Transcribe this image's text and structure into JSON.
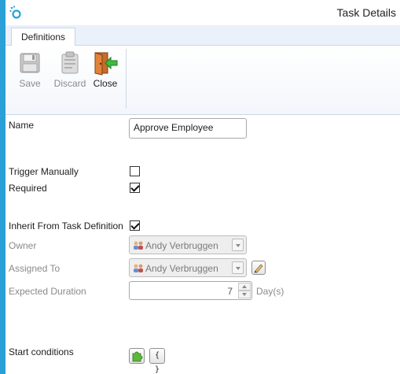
{
  "window": {
    "title": "Task Details"
  },
  "ribbon": {
    "tab": "Definitions",
    "save_label": "Save",
    "discard_label": "Discard",
    "close_label": "Close"
  },
  "form": {
    "name_label": "Name",
    "name_value": "Approve Employee",
    "trigger_manually_label": "Trigger Manually",
    "trigger_manually_checked": false,
    "required_label": "Required",
    "required_checked": true,
    "inherit_label": "Inherit From Task Definition",
    "inherit_checked": true,
    "owner_label": "Owner",
    "owner_value": "Andy Verbruggen",
    "assigned_label": "Assigned To",
    "assigned_value": "Andy Verbruggen",
    "duration_label": "Expected Duration",
    "duration_value": "7",
    "duration_unit": "Day(s)",
    "start_conditions_label": "Start conditions",
    "braces_label": "{ }"
  },
  "icons": {
    "app": "app-logo-icon",
    "save": "floppy-disk-icon",
    "discard": "clipboard-icon",
    "close": "door-exit-icon",
    "person": "person-icon",
    "edit": "pencil-icon",
    "puzzle": "puzzle-icon"
  },
  "colors": {
    "accent": "#2aa0d6",
    "ribbon_bg": "#eaf1fa"
  }
}
